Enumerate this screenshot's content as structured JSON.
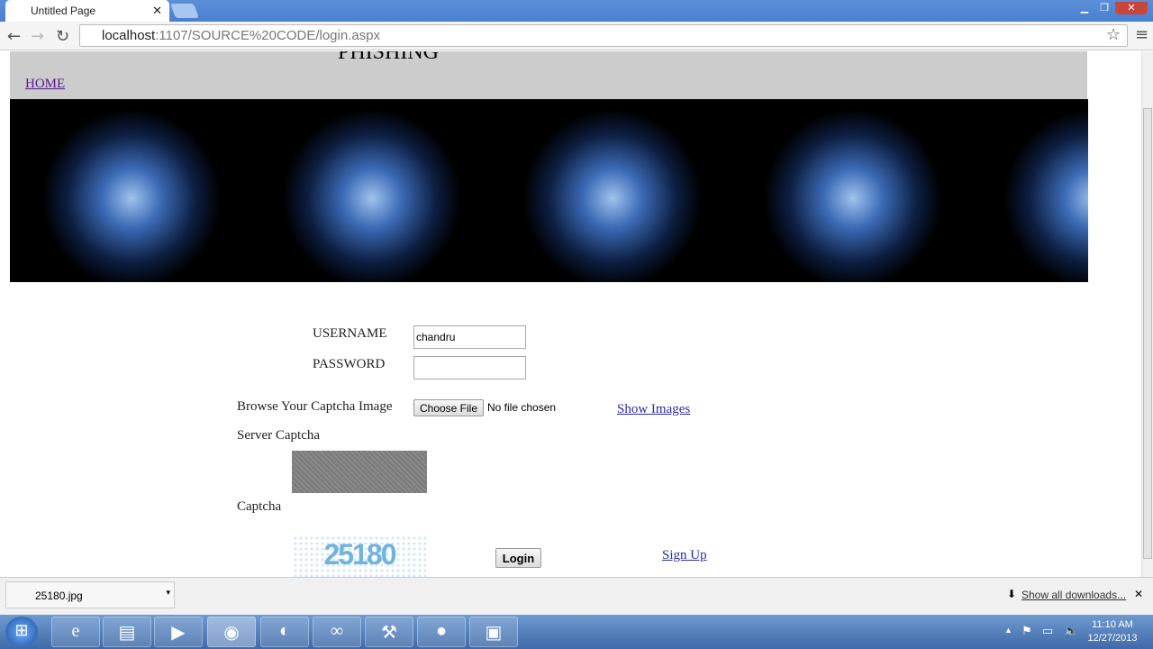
{
  "browser": {
    "tab_title": "Untitled Page",
    "url_host": "localhost",
    "url_rest": ":1107/SOURCE%20CODE/login.aspx"
  },
  "page": {
    "site_title": "PHISHING",
    "home_link": "HOME",
    "username_label": "USERNAME",
    "username_value": "chandru",
    "password_label": "PASSWORD",
    "password_value": "",
    "browse_label": "Browse Your Captcha Image",
    "choose_file": "Choose File",
    "no_file": "No file chosen",
    "show_images": "Show Images",
    "server_captcha_label": "Server Captcha",
    "captcha_label": "Captcha",
    "captcha_text": "25180",
    "login_button": "Login",
    "signup_link": "Sign Up"
  },
  "downloads": {
    "file": "25180.jpg",
    "show_all": "Show all downloads..."
  },
  "taskbar": {
    "time": "11:10 AM",
    "date": "12/27/2013"
  }
}
